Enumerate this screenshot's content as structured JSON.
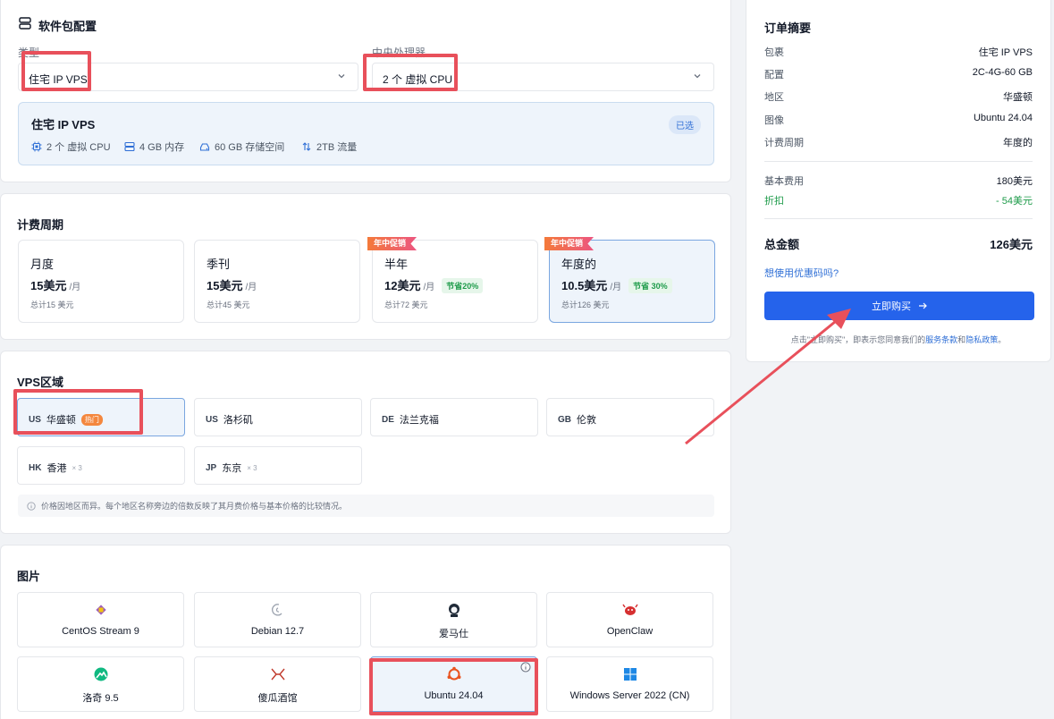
{
  "package": {
    "title": "软件包配置",
    "type_label": "类型",
    "type_value": "住宅 IP VPS",
    "cpu_label": "中央处理器",
    "cpu_value": "2 个 虚拟 CPU",
    "selected": {
      "name": "住宅 IP VPS",
      "badge": "已选",
      "cpu": "2 个 虚拟 CPU",
      "ram": "4 GB 内存",
      "storage": "60 GB 存储空间",
      "traffic": "2TB 流量"
    }
  },
  "billing": {
    "title": "计费周期",
    "plans": [
      {
        "name": "月度",
        "price": "15美元",
        "unit": "/月",
        "save": "",
        "total": "总计15 美元",
        "ribbon": ""
      },
      {
        "name": "季刊",
        "price": "15美元",
        "unit": "/月",
        "save": "",
        "total": "总计45 美元",
        "ribbon": ""
      },
      {
        "name": "半年",
        "price": "12美元",
        "unit": "/月",
        "save": "节省20%",
        "total": "总计72 美元",
        "ribbon": "年中促销"
      },
      {
        "name": "年度的",
        "price": "10.5美元",
        "unit": "/月",
        "save": "节省 30%",
        "total": "总计126 美元",
        "ribbon": "年中促销"
      }
    ]
  },
  "region": {
    "title": "VPS区域",
    "items": [
      {
        "code": "US",
        "name": "华盛顿",
        "tag": "热门",
        "mult": ""
      },
      {
        "code": "US",
        "name": "洛杉矶",
        "tag": "",
        "mult": ""
      },
      {
        "code": "DE",
        "name": "法兰克福",
        "tag": "",
        "mult": ""
      },
      {
        "code": "GB",
        "name": "伦敦",
        "tag": "",
        "mult": ""
      },
      {
        "code": "HK",
        "name": "香港",
        "tag": "",
        "mult": "× 3"
      },
      {
        "code": "JP",
        "name": "东京",
        "tag": "",
        "mult": "× 3"
      }
    ],
    "note": "价格因地区而异。每个地区名称旁边的倍数反映了其月费价格与基本价格的比较情况。"
  },
  "images": {
    "title": "图片",
    "items": [
      {
        "label": "CentOS Stream 9",
        "icon": "centos-icon"
      },
      {
        "label": "Debian 12.7",
        "icon": "debian-icon"
      },
      {
        "label": "爱马仕",
        "icon": "hermes-icon"
      },
      {
        "label": "OpenClaw",
        "icon": "openclaw-icon"
      },
      {
        "label": "洛奇 9.5",
        "icon": "rocky-icon"
      },
      {
        "label": "傻瓜酒馆",
        "icon": "tavern-icon"
      },
      {
        "label": "Ubuntu 24.04",
        "icon": "ubuntu-icon"
      },
      {
        "label": "Windows Server 2022 (CN)",
        "icon": "windows-icon"
      }
    ]
  },
  "summary": {
    "title": "订单摘要",
    "rows": [
      {
        "k": "包裹",
        "v": "住宅 IP VPS"
      },
      {
        "k": "配置",
        "v": "2C-4G-60 GB"
      },
      {
        "k": "地区",
        "v": "华盛顿"
      },
      {
        "k": "图像",
        "v": "Ubuntu 24.04"
      },
      {
        "k": "计费周期",
        "v": "年度的"
      }
    ],
    "base_label": "基本费用",
    "base_value": "180美元",
    "discount_label": "折扣",
    "discount_value": "- 54美元",
    "total_label": "总金额",
    "total_value": "126美元",
    "promo": "想使用优惠码吗?",
    "buy": "立即购买",
    "terms_prefix": "点击\"立即购买\"，即表示您同意我们的",
    "terms_link1": "服务条款",
    "terms_and": "和",
    "terms_link2": "隐私政策",
    "terms_suffix": "。"
  },
  "colors": {
    "accent": "#2563eb",
    "highlight": "#e8505b",
    "discount": "#1e9b4a"
  }
}
